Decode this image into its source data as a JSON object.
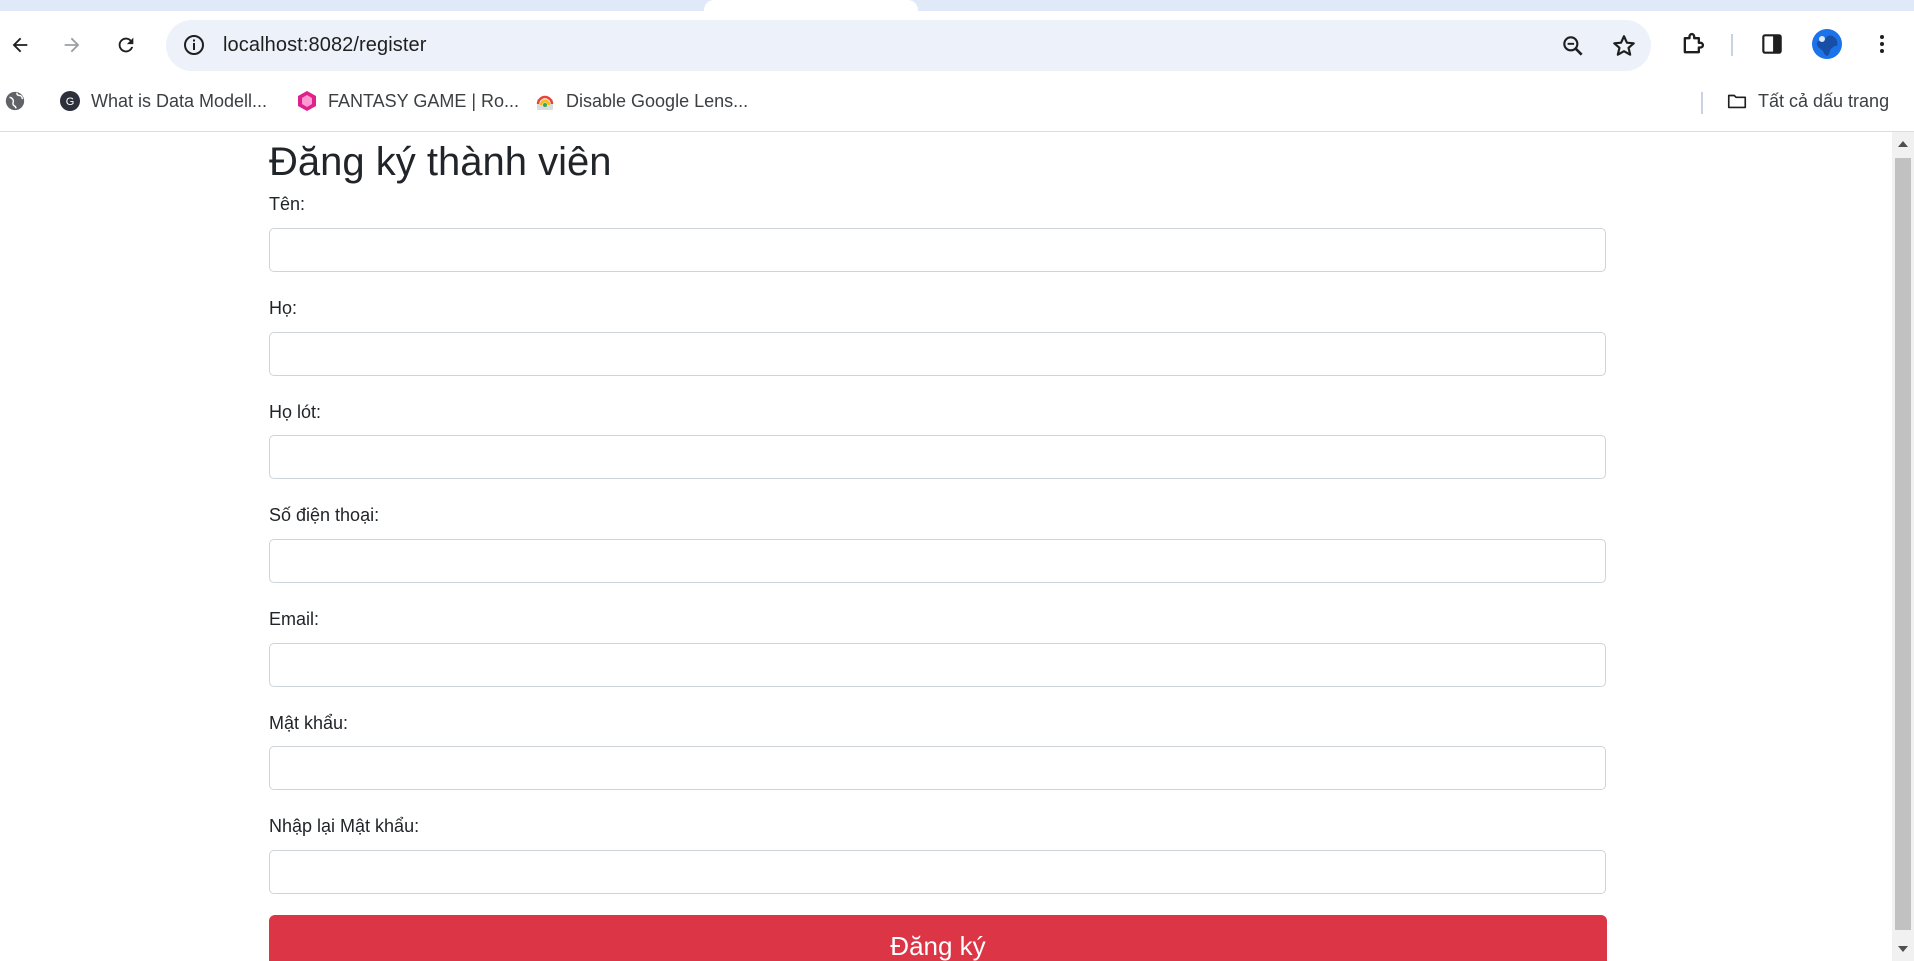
{
  "browser": {
    "url": "localhost:8082/register",
    "icons": {
      "back": "back-arrow-icon",
      "forward": "forward-arrow-icon",
      "reload": "reload-icon",
      "site_info": "info-icon",
      "zoom": "zoom-icon",
      "bookmark_star": "star-icon",
      "extensions": "puzzle-icon",
      "side_panel": "side-panel-icon",
      "profile": "avatar",
      "menu": "kebab-menu-icon"
    },
    "bookmarks": [
      {
        "label": "What is Data Modell...",
        "icon": "site-favicon"
      },
      {
        "label": "FANTASY GAME | Ro...",
        "icon": "game-favicon"
      },
      {
        "label": "Disable Google Lens...",
        "icon": "chrome-store-favicon"
      }
    ],
    "all_bookmarks_label": "Tất cả dấu trang"
  },
  "page": {
    "title": "Đăng ký thành viên",
    "fields": [
      {
        "label": "Tên:",
        "value": ""
      },
      {
        "label": "Họ:",
        "value": ""
      },
      {
        "label": "Họ lót:",
        "value": ""
      },
      {
        "label": "Số điện thoại:",
        "value": ""
      },
      {
        "label": "Email:",
        "value": ""
      },
      {
        "label": "Mật khẩu:",
        "value": ""
      },
      {
        "label": "Nhập lại Mật khẩu:",
        "value": ""
      }
    ],
    "submit_label": "Đăng ký"
  },
  "colors": {
    "submit_button": "#dc3545",
    "omnibox_bg": "#edf2fa",
    "tabstrip_bg": "#dfe9f8"
  }
}
